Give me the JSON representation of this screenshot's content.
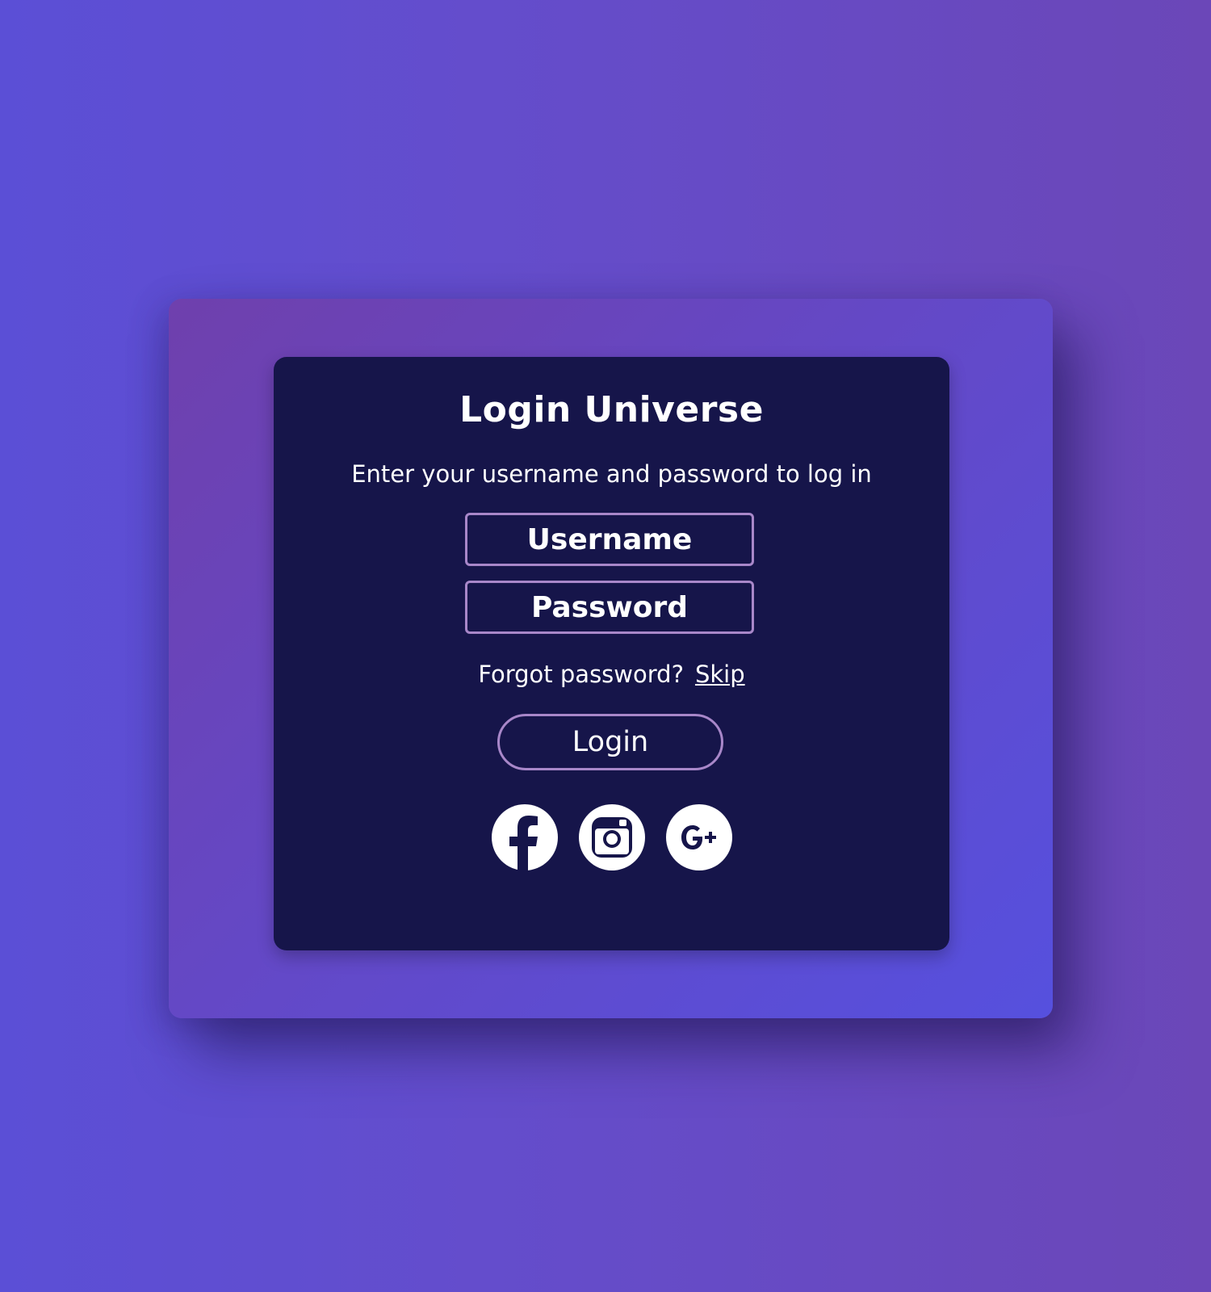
{
  "card": {
    "title": "Login Universe",
    "subtitle": "Enter your username and password to log in"
  },
  "form": {
    "username_placeholder": "Username",
    "password_placeholder": "Password",
    "forgot_text": "Forgot password?",
    "skip_link": "Skip",
    "login_label": "Login"
  },
  "social": {
    "icons": [
      "facebook-icon",
      "instagram-icon",
      "google-plus-icon"
    ]
  },
  "colors": {
    "background_start": "#5b4fd6",
    "background_end": "#6b47b8",
    "card_bg": "#16154a",
    "border_accent": "#a887c9",
    "text": "#ffffff"
  }
}
